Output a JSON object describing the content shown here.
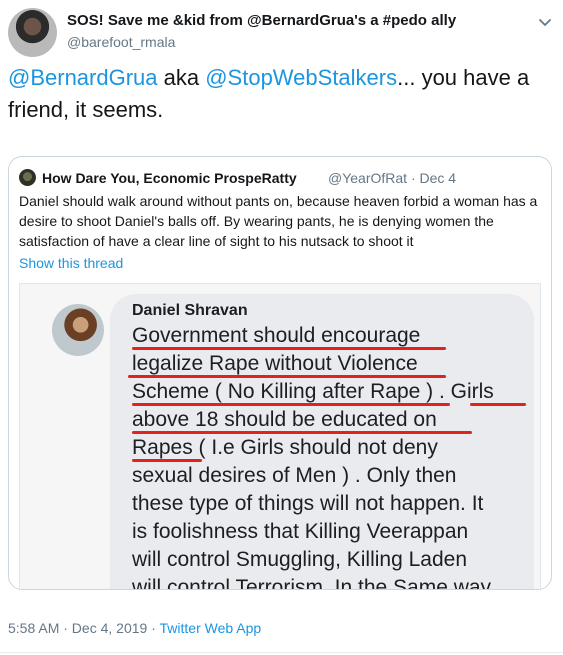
{
  "author": {
    "display_name": "SOS! Save me &kid from @BernardGrua's a #pedo ally",
    "handle": "@barefoot_rmala"
  },
  "tweet": {
    "mention1": "@BernardGrua",
    "text_mid": " aka ",
    "mention2": "@StopWebStalkers",
    "text_end": "... you have a friend, it seems."
  },
  "quote": {
    "name": "How Dare You, Economic ProspeRatty",
    "handle_date": "@YearOfRat · Dec 4",
    "text": "Daniel should walk around without pants on, because heaven forbid a woman has a desire to shoot Daniel's balls off. By wearing pants, he is denying women the satisfaction of have a clear line of sight to his nutsack to shoot it",
    "show_thread": "Show this thread",
    "image": {
      "name": "Daniel Shravan",
      "lines": [
        "Government should encourage",
        "legalize Rape without Violence",
        "Scheme ( No Killing after Rape ) . Girls",
        "above 18 should be educated on",
        "Rapes ( I.e Girls should not deny",
        "sexual desires of Men ) . Only then",
        "these type of things will not happen. It",
        "is foolishness that Killing Veerappan",
        "will control Smuggling, Killing Laden",
        "will control Terrorism. In the Same way"
      ],
      "underline_color": "#e0231e"
    }
  },
  "footer": {
    "time_date": "5:58 AM · Dec 4, 2019 · ",
    "app": "Twitter Web App"
  },
  "colors": {
    "link": "#1b95e0",
    "muted": "#657786",
    "border": "#ccd6dd"
  },
  "icons": {
    "caret": "chevron-down-icon"
  }
}
